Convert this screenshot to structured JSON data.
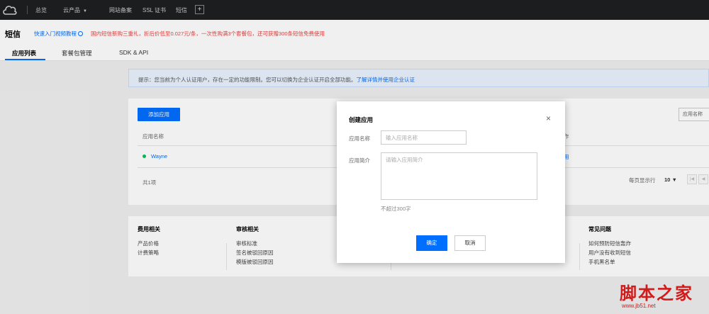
{
  "topbar": {
    "nav": [
      {
        "label": "总览"
      },
      {
        "label": "云产品"
      },
      {
        "label": "网站备案"
      },
      {
        "label": "SSL 证书"
      },
      {
        "label": "短信"
      }
    ],
    "add_icon": "+"
  },
  "header": {
    "title": "短信",
    "tutorial_link": "快速入门视频教程",
    "promo": "国内短信新购三重礼，折后价低至0.027元/条，一次性购满3个套餐包，还可获赠300条短信免费使用",
    "tabs": [
      {
        "label": "应用列表",
        "active": true
      },
      {
        "label": "套餐包管理",
        "active": false
      },
      {
        "label": "SDK & API",
        "active": false
      }
    ]
  },
  "notice": {
    "prefix": "提示：您当前为个人认证用户，存在一定的功能限制。您可以切换为企业认证开启全部功能。",
    "link": "了解详情并使用企业认证"
  },
  "app_list": {
    "add_button": "添加应用",
    "search_placeholder": "应用名称",
    "col_name": "应用名称",
    "col_ops_partial": "作",
    "rows": [
      {
        "name": "Wayne",
        "ops_partial": "用",
        "status_color": "#0abf5b"
      }
    ],
    "total": "共1项",
    "per_page_label": "每页显示行",
    "per_page_value": "10"
  },
  "help": {
    "columns": [
      {
        "heading": "费用相关",
        "links": [
          "产品价格",
          "计费策略"
        ]
      },
      {
        "heading": "审核相关",
        "links": [
          "审核标准",
          "签名被驳回原因",
          "模版被驳回原因"
        ]
      },
      {
        "heading": "常见问题",
        "links": [
          "如何预防短信轰炸",
          "用户没有收到短信",
          "手机黑名单"
        ]
      }
    ]
  },
  "modal": {
    "title": "创建应用",
    "close_icon": "×",
    "name_label": "应用名称",
    "name_placeholder": "输入应用名称",
    "desc_label": "应用简介",
    "desc_placeholder": "请输入应用简介",
    "hint": "不超过300字",
    "ok_label": "确定",
    "cancel_label": "取消"
  },
  "watermark": {
    "main": "脚本之家",
    "sub": "www.jb51.net"
  },
  "colors": {
    "accent": "#006eff",
    "danger": "#e54545",
    "topbar": "#1e1f21",
    "status_ok": "#0abf5b"
  }
}
